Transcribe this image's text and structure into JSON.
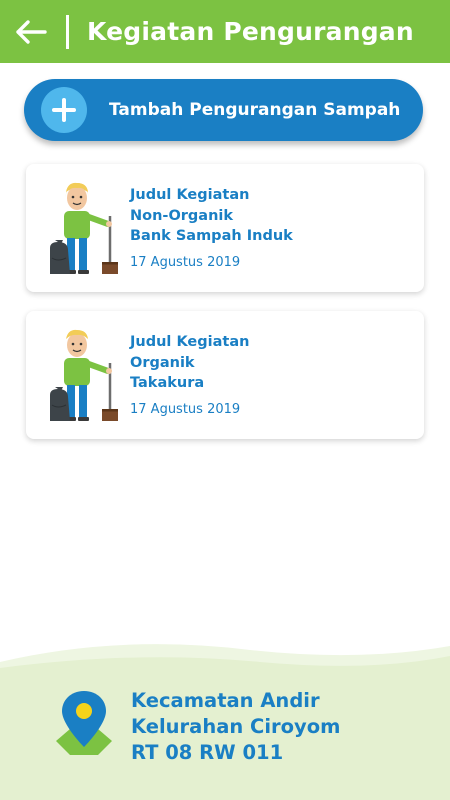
{
  "header": {
    "title": "Kegiatan Pengurangan"
  },
  "add_button": {
    "label": "Tambah Pengurangan Sampah"
  },
  "activities": [
    {
      "title_lines": [
        "Judul Kegiatan",
        "Non-Organik",
        "Bank Sampah Induk"
      ],
      "date": "17 Agustus 2019"
    },
    {
      "title_lines": [
        "Judul Kegiatan",
        "Organik",
        "Takakura"
      ],
      "date": "17 Agustus 2019"
    }
  ],
  "location": {
    "lines": [
      "Kecamatan Andir",
      "Kelurahan Ciroyom",
      "RT 08 RW 011"
    ]
  },
  "colors": {
    "header_green": "#7cc242",
    "primary_blue": "#1a7fc4",
    "light_blue": "#4fb7ec",
    "footer_green": "#e6f2d2",
    "pin_yellow": "#f5d31b"
  },
  "icons": {
    "back": "arrow-left-icon",
    "add": "plus-icon",
    "location": "map-pin-icon"
  }
}
